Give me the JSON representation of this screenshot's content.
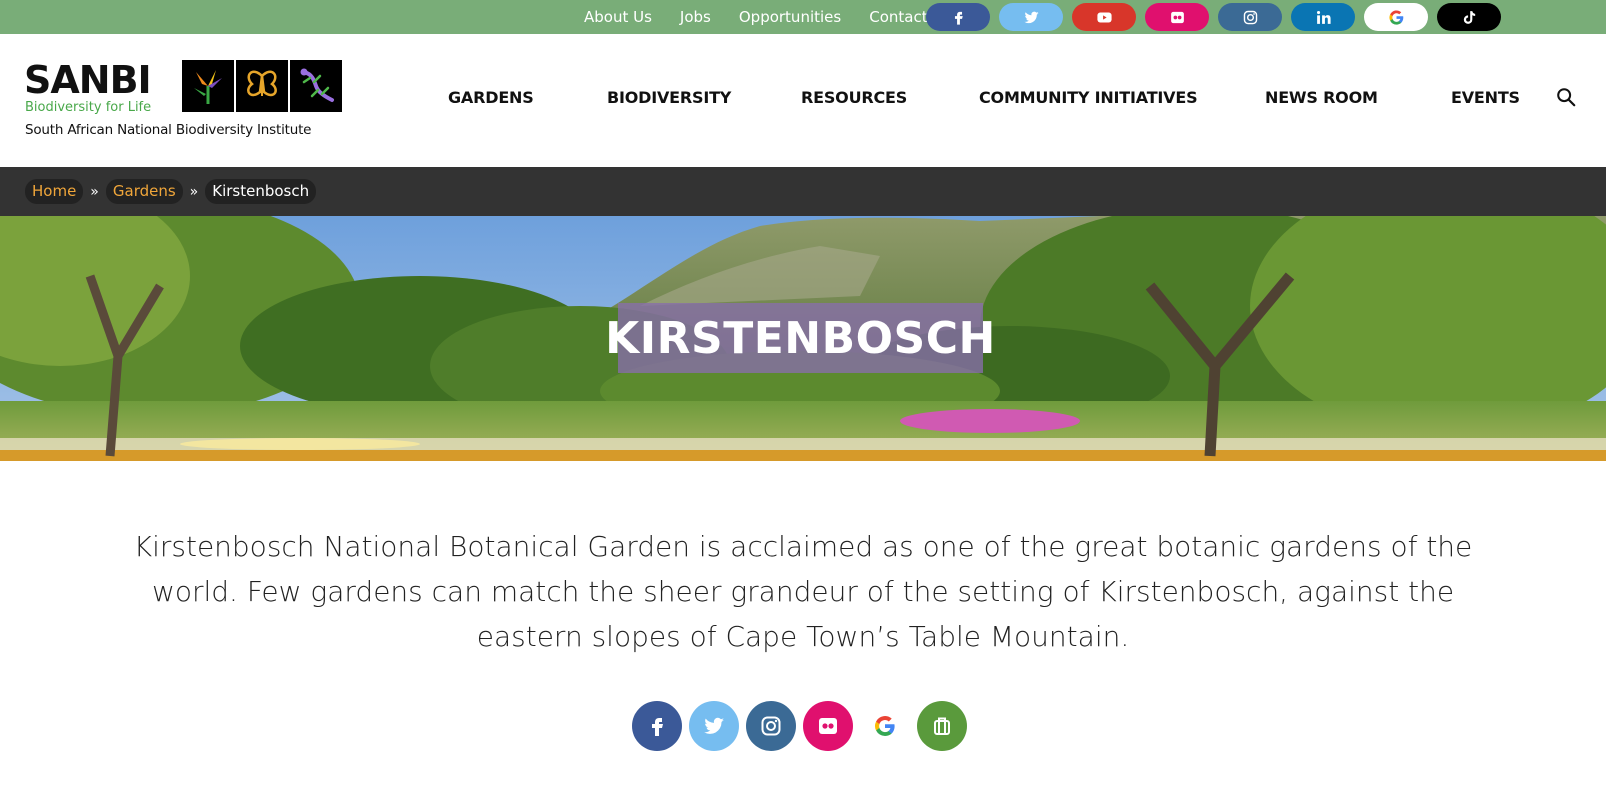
{
  "topbar": {
    "links": [
      "About Us",
      "Jobs",
      "Opportunities",
      "Contact"
    ],
    "social": [
      {
        "icon": "facebook-icon",
        "color": "#3b5998"
      },
      {
        "icon": "twitter-icon",
        "color": "#76bdf0"
      },
      {
        "icon": "youtube-icon",
        "color": "#d8362a"
      },
      {
        "icon": "flickr-icon",
        "color": "#e0106e"
      },
      {
        "icon": "instagram-icon",
        "color": "#3b6a95"
      },
      {
        "icon": "linkedin-icon",
        "color": "#0a75b3"
      },
      {
        "icon": "google-icon",
        "color": "#ffffff"
      },
      {
        "icon": "tiktok-icon",
        "color": "#000000"
      }
    ]
  },
  "logo": {
    "word": "SANBI",
    "tagline": "Biodiversity for Life",
    "full_name": "South African National Biodiversity Institute"
  },
  "nav": {
    "items": [
      "GARDENS",
      "BIODIVERSITY",
      "RESOURCES",
      "COMMUNITY INITIATIVES",
      "NEWS ROOM",
      "EVENTS"
    ]
  },
  "breadcrumb": {
    "home": "Home",
    "gardens": "Gardens",
    "current": "Kirstenbosch",
    "separator": "»"
  },
  "hero": {
    "title": "KIRSTENBOSCH"
  },
  "intro": {
    "text": "Kirstenbosch National Botanical Garden is acclaimed as one of the great botanic gardens of the world. Few gardens can match the sheer grandeur of the setting of Kirstenbosch, against the eastern slopes of Cape Town’s Table Mountain."
  },
  "follow": [
    {
      "icon": "facebook-icon",
      "color": "#3b5998"
    },
    {
      "icon": "twitter-icon",
      "color": "#76bdf0"
    },
    {
      "icon": "instagram-icon",
      "color": "#3b6a95"
    },
    {
      "icon": "flickr-icon",
      "color": "#e0106e"
    },
    {
      "icon": "google-icon",
      "color": "#ffffff"
    },
    {
      "icon": "tripadvisor-icon",
      "color": "#5a9a3c"
    }
  ]
}
